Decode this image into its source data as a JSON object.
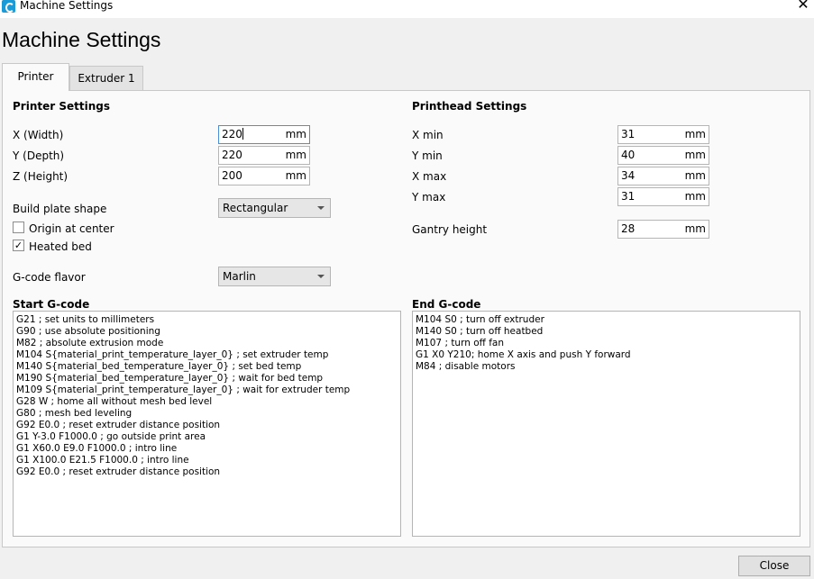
{
  "window": {
    "title": "Machine Settings",
    "close_glyph": "✕"
  },
  "dialog_title": "Machine Settings",
  "tabs": [
    {
      "label": "Printer",
      "active": true
    },
    {
      "label": "Extruder 1",
      "active": false
    }
  ],
  "printer_settings": {
    "title": "Printer Settings",
    "x_width": {
      "label": "X (Width)",
      "value": "220",
      "unit": "mm"
    },
    "y_depth": {
      "label": "Y (Depth)",
      "value": "220",
      "unit": "mm"
    },
    "z_height": {
      "label": "Z (Height)",
      "value": "200",
      "unit": "mm"
    },
    "build_plate_shape": {
      "label": "Build plate shape",
      "value": "Rectangular"
    },
    "origin_at_center": {
      "label": "Origin at center",
      "checked": false
    },
    "heated_bed": {
      "label": "Heated bed",
      "checked": true,
      "check_glyph": "✓"
    },
    "gcode_flavor": {
      "label": "G-code flavor",
      "value": "Marlin"
    }
  },
  "printhead_settings": {
    "title": "Printhead Settings",
    "x_min": {
      "label": "X min",
      "value": "31",
      "unit": "mm"
    },
    "y_min": {
      "label": "Y min",
      "value": "40",
      "unit": "mm"
    },
    "x_max": {
      "label": "X max",
      "value": "34",
      "unit": "mm"
    },
    "y_max": {
      "label": "Y max",
      "value": "31",
      "unit": "mm"
    },
    "gantry_height": {
      "label": "Gantry height",
      "value": "28",
      "unit": "mm"
    }
  },
  "start_gcode": {
    "title": "Start G-code",
    "lines": [
      "G21 ; set units to millimeters",
      "G90 ; use absolute positioning",
      "M82 ; absolute extrusion mode",
      "M104 S{material_print_temperature_layer_0} ; set extruder temp",
      "M140 S{material_bed_temperature_layer_0} ; set bed temp",
      "M190 S{material_bed_temperature_layer_0} ; wait for bed temp",
      "M109 S{material_print_temperature_layer_0} ; wait for extruder temp",
      "G28 W ; home all without mesh bed level",
      "G80 ; mesh bed leveling",
      "G92 E0.0 ; reset extruder distance position",
      "G1 Y-3.0 F1000.0 ; go outside print area",
      "G1 X60.0 E9.0 F1000.0 ; intro line",
      "G1 X100.0 E21.5 F1000.0 ; intro line",
      "G92 E0.0 ; reset extruder distance position"
    ]
  },
  "end_gcode": {
    "title": "End G-code",
    "lines": [
      "M104 S0 ; turn off extruder",
      "M140 S0 ; turn off heatbed",
      "M107 ; turn off fan",
      "G1 X0 Y210; home X axis and push Y forward",
      "M84 ; disable motors"
    ]
  },
  "footer": {
    "close_label": "Close"
  },
  "colors": {
    "accent": "#1a9ad6",
    "focus_border": "#4a90d9",
    "panel_bg": "#fafafa",
    "window_bg": "#f0f0f0"
  }
}
